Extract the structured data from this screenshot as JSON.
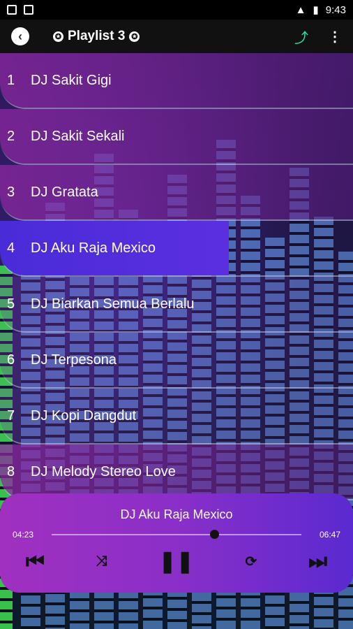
{
  "status_bar": {
    "time": "9:43",
    "icons_left": [
      "image-icon",
      "photo-icon"
    ],
    "icons_right": [
      "wifi-icon",
      "battery-icon"
    ]
  },
  "toolbar": {
    "title": "Playlist 3",
    "back_icon": "back-arrow-icon",
    "share_icon": "share-icon",
    "more_icon": "more-vert-icon"
  },
  "playlist": [
    {
      "num": "1",
      "title": "DJ Sakit Gigi"
    },
    {
      "num": "2",
      "title": "DJ Sakit Sekali"
    },
    {
      "num": "3",
      "title": "DJ Gratata"
    },
    {
      "num": "4",
      "title": "DJ Aku Raja Mexico"
    },
    {
      "num": "5",
      "title": "DJ Biarkan Semua Berlalu"
    },
    {
      "num": "6",
      "title": "DJ Terpesona"
    },
    {
      "num": "7",
      "title": "DJ Kopi Dangdut"
    },
    {
      "num": "8",
      "title": "DJ Melody Stereo Love"
    }
  ],
  "now_playing": {
    "title": "DJ Aku Raja Mexico",
    "elapsed": "04:23",
    "duration": "06:47",
    "progress": 0.65
  },
  "colors": {
    "accent": "#1de9b6",
    "player_gradient_start": "#a030c0",
    "player_gradient_end": "#5a2ad0",
    "active_row": "#4a2bd8"
  }
}
